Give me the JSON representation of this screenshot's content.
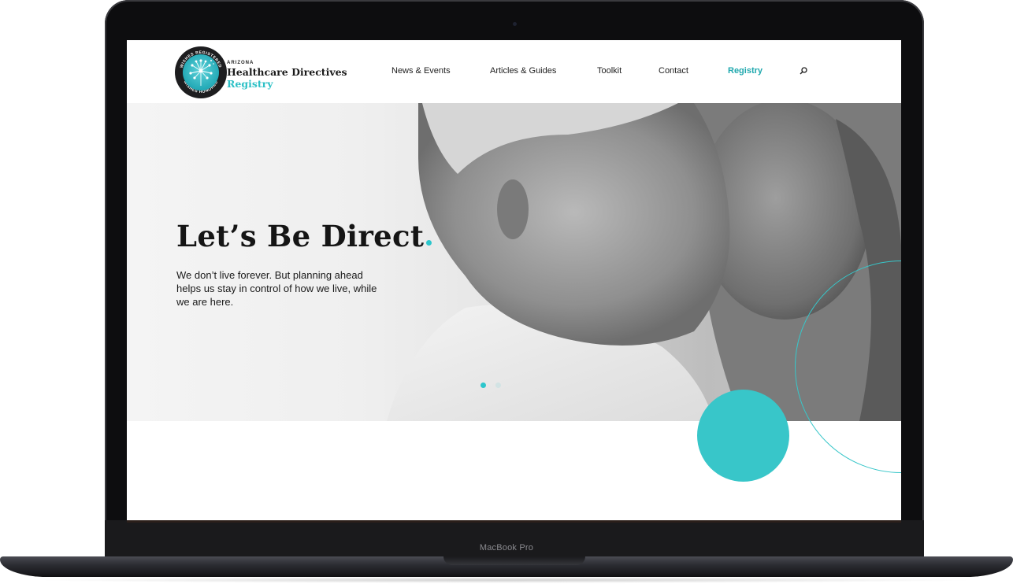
{
  "device": {
    "label": "MacBook Pro"
  },
  "header": {
    "logo": {
      "ring_top": "WISHES REGISTERED",
      "ring_bottom": "WISHES HONORED",
      "state": "ARIZONA",
      "name": "Healthcare Directives",
      "sub": "Registry"
    },
    "nav": [
      {
        "label": "News & Events"
      },
      {
        "label": "Articles & Guides"
      },
      {
        "label": "Toolkit"
      },
      {
        "label": "Contact"
      },
      {
        "label": "Registry",
        "active": true
      }
    ],
    "search_icon": "search-icon"
  },
  "hero": {
    "title": "Let’s Be Direct",
    "body": "We don’t live forever. But planning ahead helps us stay in control of how we live, while we are here.",
    "slides_total": 2,
    "slide_active": 1
  },
  "colors": {
    "accent": "#2cc6cc",
    "text": "#151515"
  }
}
